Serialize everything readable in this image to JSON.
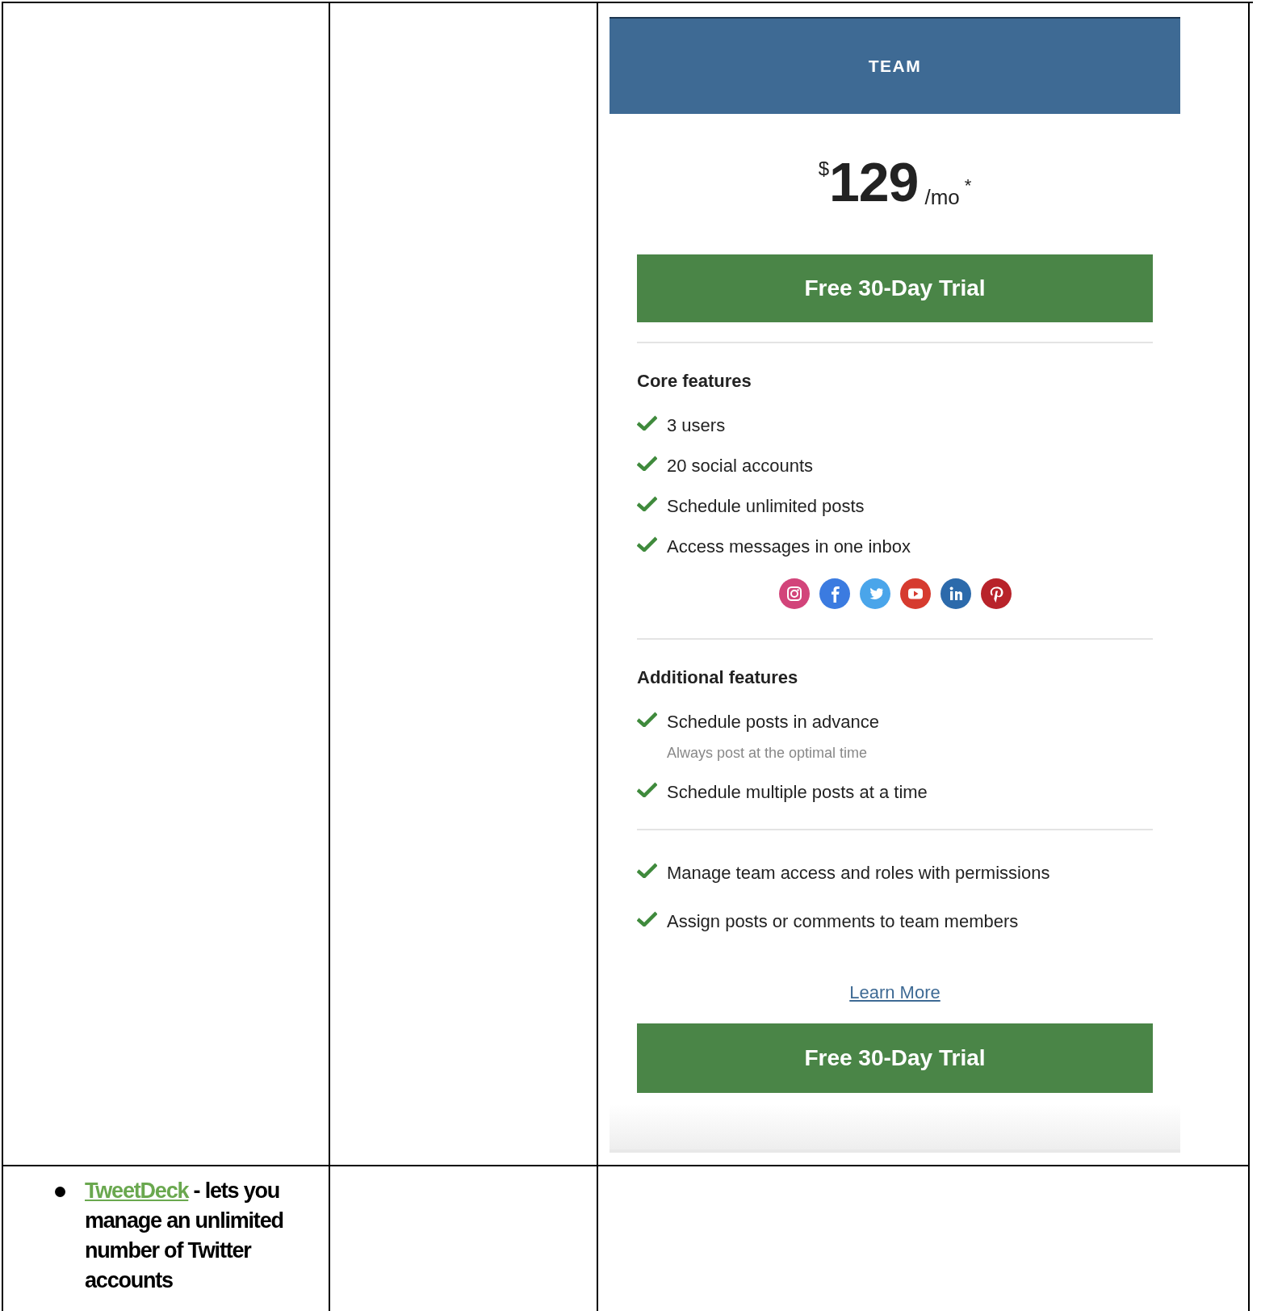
{
  "plan": {
    "title": "TEAM",
    "price": {
      "currency": "$",
      "amount": "129",
      "period": "/mo",
      "note": "*"
    },
    "cta_top": "Free 30-Day Trial",
    "sections": [
      {
        "heading": "Core features",
        "items": [
          {
            "text": "3 users"
          },
          {
            "text": "20 social accounts"
          },
          {
            "text": "Schedule unlimited posts"
          },
          {
            "text": "Access messages in one inbox"
          }
        ],
        "networks": [
          {
            "kind": "camera"
          },
          {
            "kind": "f"
          },
          {
            "kind": "bird"
          },
          {
            "kind": "play"
          },
          {
            "kind": "in"
          },
          {
            "kind": "p"
          }
        ]
      },
      {
        "heading": "Additional features",
        "items": [
          {
            "text": "Schedule posts in advance",
            "note": "Always post at the optimal time"
          },
          {
            "text": "Schedule multiple posts at a time"
          }
        ]
      },
      {
        "items": [
          {
            "text": "Manage team access and roles with permissions"
          },
          {
            "text": "Assign posts or comments to team members"
          }
        ]
      }
    ],
    "learn_more": "Learn More",
    "cta_bottom": "Free 30-Day Trial"
  },
  "list_item": {
    "link": "TweetDeck",
    "text": " -  lets you manage an unlimited number of Twitter accounts"
  }
}
